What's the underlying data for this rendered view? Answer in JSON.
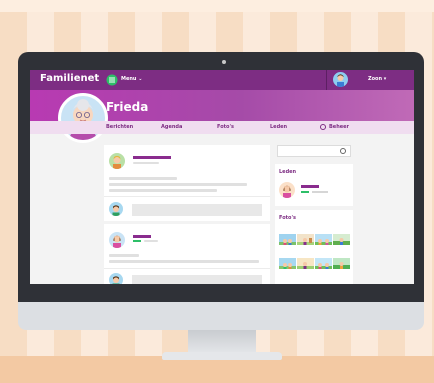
{
  "app": {
    "logo": "Familienet",
    "menu_label": "Menu ⌄",
    "user_menu_label": "Zoon ▾"
  },
  "profile": {
    "name": "Frieda"
  },
  "nav": {
    "items": [
      "Berichten",
      "Agenda",
      "Foto's",
      "Leden",
      "Beheer"
    ]
  },
  "sidebar": {
    "members_title": "Leden",
    "photos_title": "Foto's"
  },
  "colors": {
    "header": "#7d2d83",
    "banner": "#b83ab2",
    "accent_green": "#2dbf68"
  }
}
